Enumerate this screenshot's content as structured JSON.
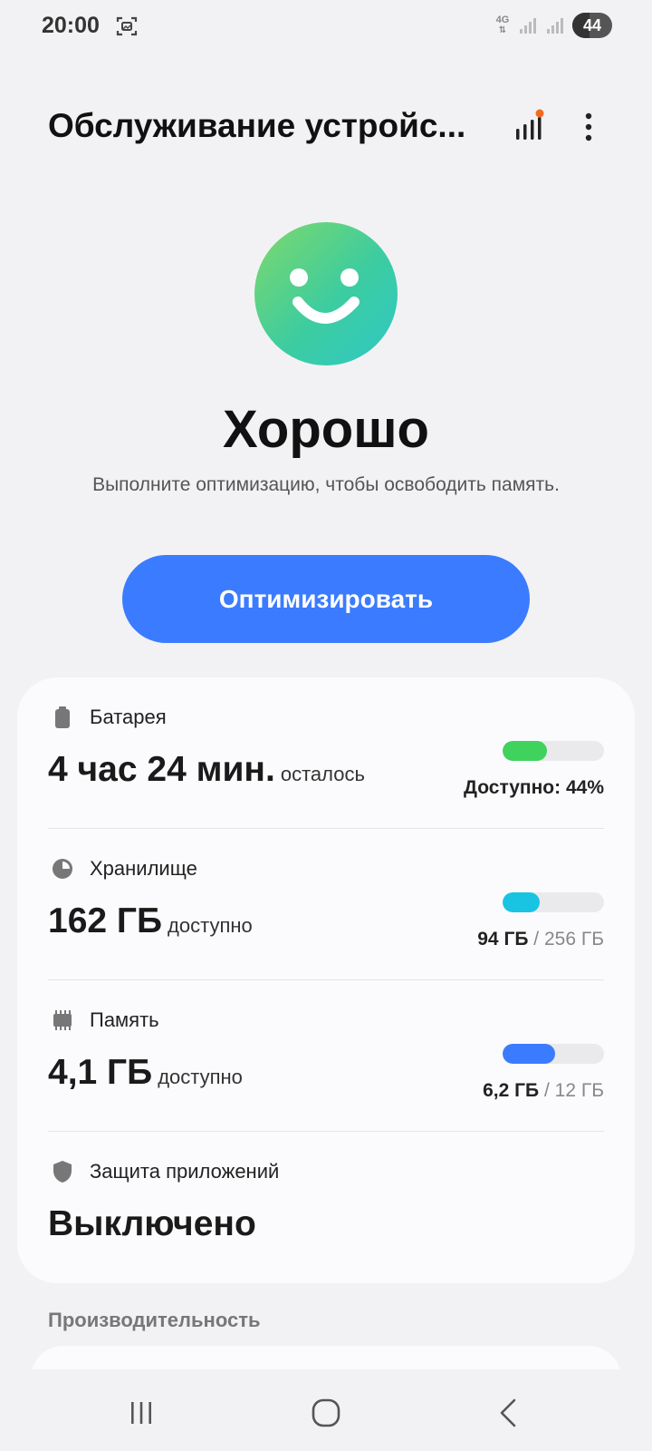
{
  "status_bar": {
    "time": "20:00",
    "network": "4G",
    "battery_level": "44",
    "battery_fraction": 0.44,
    "icons": [
      "screenshot-icon",
      "signal-icon",
      "signal-icon",
      "battery-icon"
    ]
  },
  "app_bar": {
    "title": "Обслуживание устройс...",
    "actions": [
      "performance-bars-icon",
      "more-options-icon"
    ],
    "accent_dot_color": "#f26b1d"
  },
  "hero": {
    "status": "Хорошо",
    "description": "Выполните оптимизацию, чтобы освободить память.",
    "button_label": "Оптимизировать",
    "button_color": "#3b7bff"
  },
  "battery": {
    "label": "Батарея",
    "value": "4 час 24 мин.",
    "suffix": "осталось",
    "right_text": "Доступно: 44%",
    "fill_fraction": 0.44,
    "color": "#3fd25c"
  },
  "storage": {
    "label": "Хранилище",
    "value": "162 ГБ",
    "suffix": "доступно",
    "used": "94 ГБ",
    "total": "/ 256 ГБ",
    "fill_fraction": 0.37,
    "color": "#19c4e3"
  },
  "memory": {
    "label": "Память",
    "value": "4,1 ГБ",
    "suffix": "доступно",
    "used": "6,2 ГБ",
    "total": "/ 12 ГБ",
    "fill_fraction": 0.52,
    "color": "#3b7bff"
  },
  "app_protection": {
    "label": "Защита приложений",
    "value": "Выключено"
  },
  "sections": {
    "performance": "Производительность"
  },
  "nav": {
    "icons": [
      "recent-apps-icon",
      "home-icon",
      "back-icon"
    ]
  }
}
